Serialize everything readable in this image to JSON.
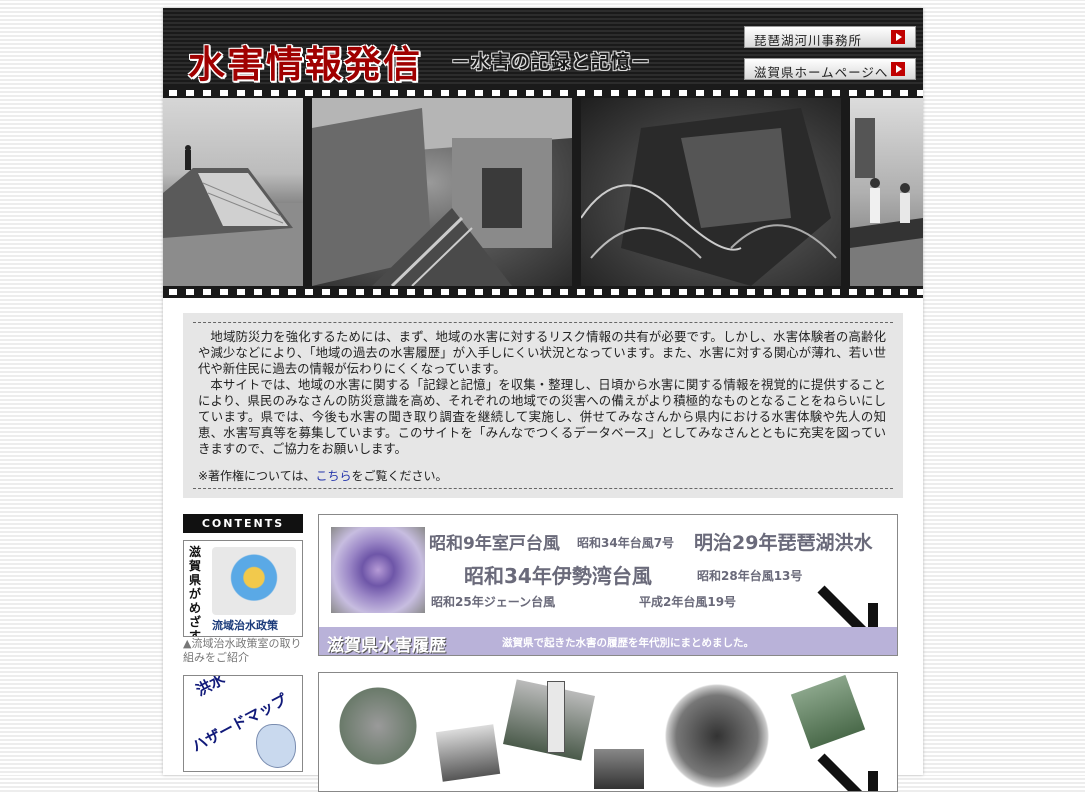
{
  "header": {
    "title": "水害情報発信",
    "subtitle": "－水害の記録と記憶－",
    "links": [
      {
        "label": "琵琶湖河川事務所"
      },
      {
        "label": "滋賀県ホームページへ"
      }
    ]
  },
  "intro": {
    "paragraphs": [
      "地域防災力を強化するためには、まず、地域の水害に対するリスク情報の共有が必要です。しかし、水害体験者の高齢化や減少などにより、「地域の過去の水害履歴」が入手しにくい状況となっています。また、水害に対する関心が薄れ、若い世代や新住民に過去の情報が伝わりにくくなっています。",
      "本サイトでは、地域の水害に関する「記録と記憶」を収集・整理し、日頃から水害に関する情報を視覚的に提供することにより、県民のみなさんの防災意識を高め、それぞれの地域での災害への備えがより積極的なものとなることをねらいにしています。県では、今後も水害の聞き取り調査を継続して実施し、併せてみなさんから県内における水害体験や先人の知恵、水害写真等を募集しています。このサイトを「みんなでつくるデータベース」としてみなさんとともに充実を図っていきますので、ご協力をお願いします。"
    ],
    "copyright_prefix": "※著作権については、",
    "copyright_link": "こちら",
    "copyright_suffix": "をご覧ください。"
  },
  "sidebar": {
    "contents_label": "CONTENTS",
    "banner1": {
      "vertical_text": "滋賀県がめざす",
      "title": "流域治水政策",
      "caption": "▲流域治水政策室の取り組みをご紹介"
    },
    "banner2": {
      "line1": "洪水",
      "line2": "ハザードマップ"
    }
  },
  "main": {
    "history_banner": {
      "items": [
        "昭和9年室戸台風",
        "昭和34年台風7号",
        "明治29年琵琶湖洪水",
        "昭和34年伊勢湾台風",
        "昭和28年台風13号",
        "昭和25年ジェーン台風",
        "平成2年台風19号"
      ],
      "title": "滋賀県水害履歴",
      "description": "滋賀県で起きた水害の履歴を年代別にまとめました。"
    }
  },
  "colors": {
    "title_red": "#a00000",
    "history_bar": "#b9b2d9",
    "link_blue": "#2233aa"
  }
}
